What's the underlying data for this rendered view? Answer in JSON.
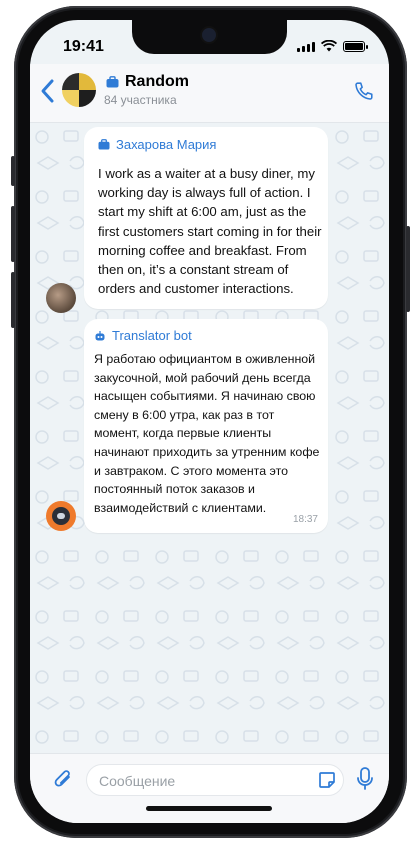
{
  "status": {
    "time": "19:41"
  },
  "header": {
    "title": "Random",
    "subtitle": "84 участника"
  },
  "messages": [
    {
      "sender": "Захарова Мария",
      "text": "I work as a waiter at a busy diner, my working day is always full of action. I start my shift at 6:00 am, just as the first customers start coming in for their morning coffee and breakfast. From then on, it’s a constant stream of orders and customer interactions."
    },
    {
      "sender": "Translator bot",
      "text": "Я работаю официантом в оживленной закусочной, мой рабочий день всегда насыщен событиями. Я начинаю свою смену в 6:00 утра, как раз в тот момент, когда первые клиенты начинают приходить за утренним кофе и завтраком. С этого момента это постоянный поток заказов и взаимодействий с клиентами.",
      "time": "18:37"
    }
  ],
  "composer": {
    "placeholder": "Сообщение"
  },
  "colors": {
    "accent": "#2f7bd6",
    "chat_bg": "#eef3f6",
    "bubble": "#ffffff"
  }
}
